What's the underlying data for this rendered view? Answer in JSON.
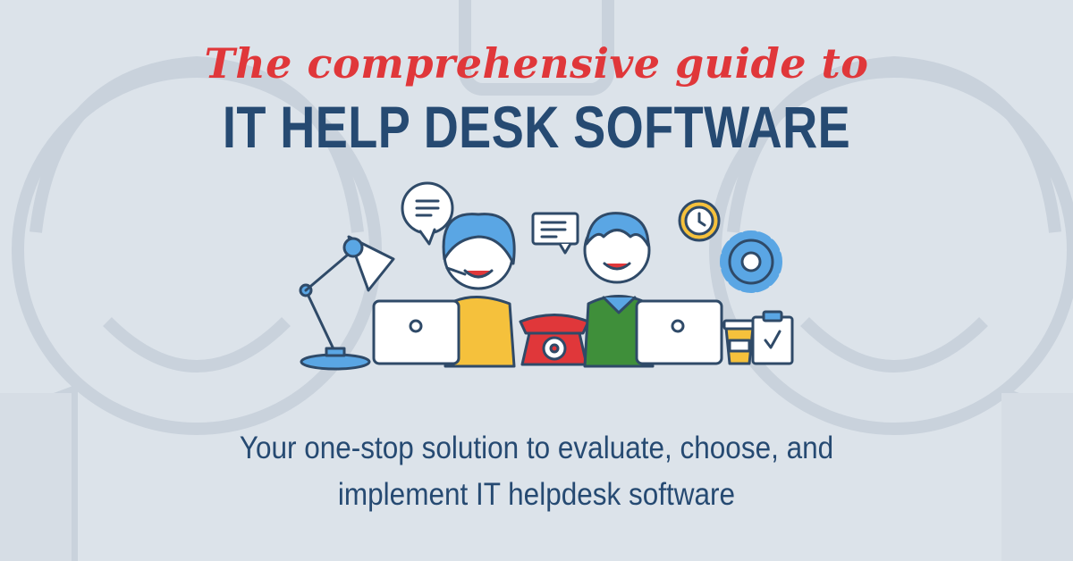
{
  "header": {
    "script_title": "The comprehensive guide to",
    "main_title": "IT HELP DESK SOFTWARE"
  },
  "tagline": {
    "line1": "Your one-stop solution to evaluate, choose, and",
    "line2": "implement IT helpdesk software"
  },
  "colors": {
    "background": "#dce3ea",
    "accent_red": "#e0373a",
    "navy": "#264a72",
    "outline": "#2f4a68",
    "blue": "#5aa6e4",
    "yellow": "#f5c13c",
    "green": "#3f8f3a"
  },
  "icons": [
    "desk-lamp-icon",
    "chat-bubble-icon",
    "message-icon",
    "clock-icon",
    "gear-icon",
    "telephone-icon",
    "laptop-icon",
    "coffee-cup-icon",
    "clipboard-check-icon"
  ]
}
